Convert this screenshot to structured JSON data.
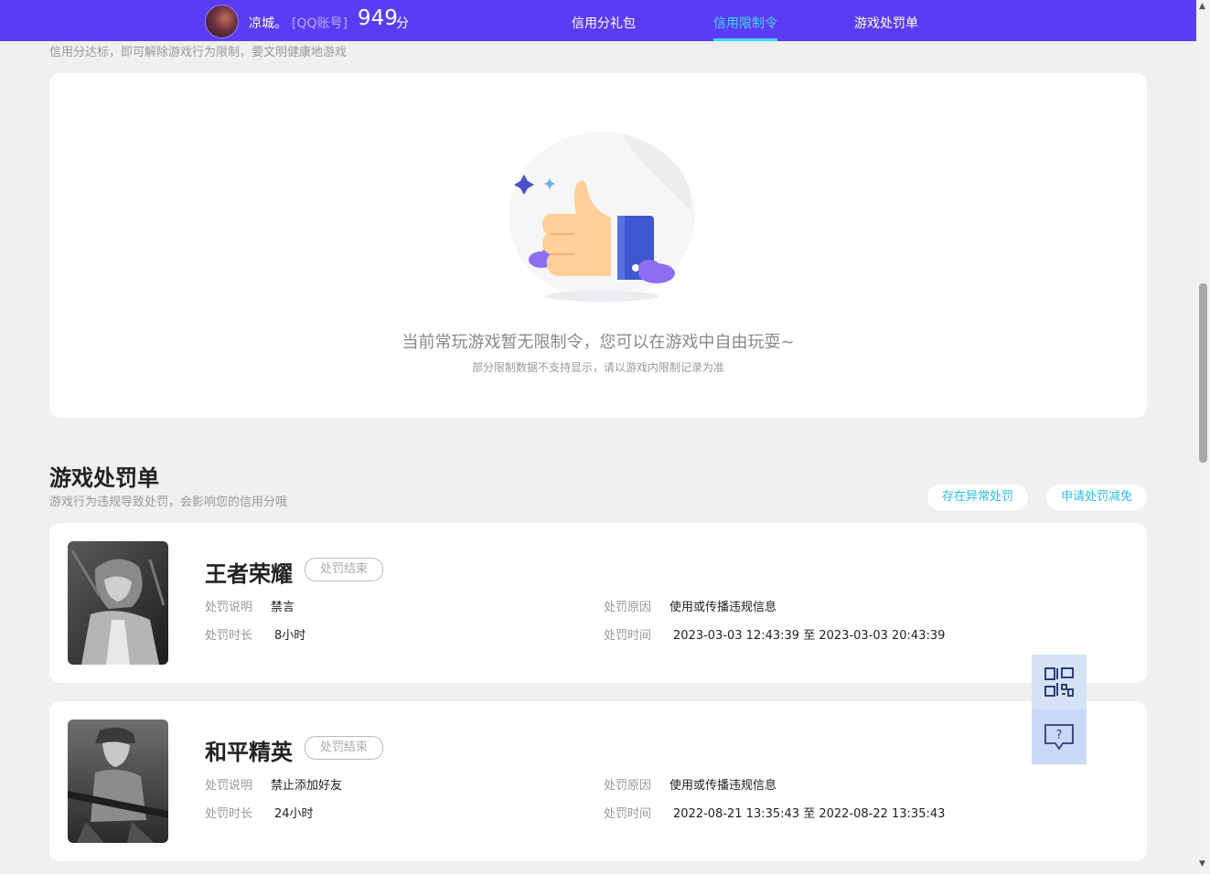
{
  "header": {
    "username": "凉城。",
    "account_type": "[QQ账号]",
    "score": "949",
    "score_unit": "分",
    "nav": [
      {
        "label": "信用分礼包"
      },
      {
        "label": "信用限制令"
      },
      {
        "label": "游戏处罚单"
      }
    ],
    "active_nav": "信用限制令"
  },
  "restriction": {
    "subtitle": "信用分达标，即可解除游戏行为限制，要文明健康地游戏",
    "empty_text": "当前常玩游戏暂无限制令，您可以在游戏中自由玩耍~",
    "empty_subtext": "部分限制数据不支持显示，请以游戏内限制记录为准"
  },
  "penalty": {
    "title": "游戏处罚单",
    "subtitle": "游戏行为违规导致处罚，会影响您的信用分哦",
    "report_button": "存在异常处罚",
    "appeal_button": "申请处罚减免",
    "cards": [
      {
        "game": "王者荣耀",
        "status": "处罚结束",
        "desc_label": "处罚说明",
        "desc": "禁言",
        "duration_label": "处罚时长",
        "duration": "8小时",
        "reason_label": "处罚原因",
        "reason": "使用或传播违规信息",
        "time_label": "处罚时间",
        "time": "2023-03-03 12:43:39 至 2023-03-03 20:43:39"
      },
      {
        "game": "和平精英",
        "status": "处罚结束",
        "desc_label": "处罚说明",
        "desc": "禁止添加好友",
        "duration_label": "处罚时长",
        "duration": "24小时",
        "reason_label": "处罚原因",
        "reason": "使用或传播违规信息",
        "time_label": "处罚时间",
        "time": "2022-08-21 13:35:43 至 2022-08-22 13:35:43"
      }
    ]
  },
  "float": {
    "qr_icon": "qrcode-icon",
    "help_icon": "help-chat-icon"
  },
  "colors": {
    "header_bg": "#5b3cf5",
    "accent": "#43d8f0",
    "page_bg": "#f0f0f0"
  }
}
